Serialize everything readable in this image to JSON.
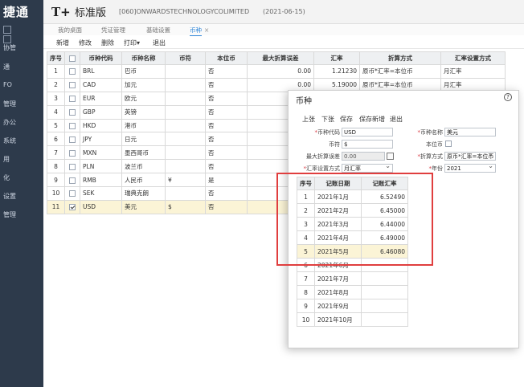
{
  "app": {
    "brand": "捷通",
    "logo_mark": "T+",
    "logo_text": "标准版",
    "company": "[060]ONWARDSTECHNOLOGYCOLIMITED",
    "date": "(2021-06-15)"
  },
  "sidebar": {
    "items": [
      "协管",
      "通",
      "FO",
      "管理",
      "办公",
      "系统",
      "用",
      "化",
      "设置",
      "管理"
    ]
  },
  "tabs": [
    {
      "label": "我的桌面"
    },
    {
      "label": "凭证管理"
    },
    {
      "label": "基础设置"
    },
    {
      "label": "币种",
      "close": "×"
    }
  ],
  "toolbar": {
    "add": "新增",
    "edit": "修改",
    "delete": "删除",
    "print": "打印",
    "print_caret": "▾",
    "exit": "退出"
  },
  "grid": {
    "headers": [
      "序号",
      "",
      "币种代码",
      "币种名称",
      "币符",
      "本位币",
      "最大折算误差",
      "汇率",
      "折算方式",
      "汇率设置方式"
    ],
    "rows": [
      {
        "no": "1",
        "code": "BRL",
        "name": "巴币",
        "symbol": "",
        "base": "否",
        "err": "0.00",
        "rate": "1.21230",
        "method": "原币*汇率=本位币",
        "setting": "月汇率",
        "checked": false
      },
      {
        "no": "2",
        "code": "CAD",
        "name": "加元",
        "symbol": "",
        "base": "否",
        "err": "0.00",
        "rate": "5.19000",
        "method": "原币*汇率=本位币",
        "setting": "月汇率",
        "checked": false
      },
      {
        "no": "3",
        "code": "EUR",
        "name": "欧元",
        "symbol": "",
        "base": "否",
        "err": "",
        "rate": "",
        "method": "",
        "setting": "",
        "checked": false
      },
      {
        "no": "4",
        "code": "GBP",
        "name": "英镑",
        "symbol": "",
        "base": "否",
        "err": "",
        "rate": "",
        "method": "",
        "setting": "",
        "checked": false
      },
      {
        "no": "5",
        "code": "HKD",
        "name": "港币",
        "symbol": "",
        "base": "否",
        "err": "",
        "rate": "",
        "method": "",
        "setting": "",
        "checked": false
      },
      {
        "no": "6",
        "code": "JPY",
        "name": "日元",
        "symbol": "",
        "base": "否",
        "err": "",
        "rate": "",
        "method": "",
        "setting": "",
        "checked": false
      },
      {
        "no": "7",
        "code": "MXN",
        "name": "墨西哥币",
        "symbol": "",
        "base": "否",
        "err": "",
        "rate": "",
        "method": "",
        "setting": "",
        "checked": false
      },
      {
        "no": "8",
        "code": "PLN",
        "name": "波兰币",
        "symbol": "",
        "base": "否",
        "err": "",
        "rate": "",
        "method": "",
        "setting": "",
        "checked": false
      },
      {
        "no": "9",
        "code": "RMB",
        "name": "人民币",
        "symbol": "¥",
        "base": "是",
        "err": "",
        "rate": "",
        "method": "",
        "setting": "",
        "checked": false
      },
      {
        "no": "10",
        "code": "SEK",
        "name": "瑞典克朗",
        "symbol": "",
        "base": "否",
        "err": "",
        "rate": "",
        "method": "",
        "setting": "",
        "checked": false
      },
      {
        "no": "11",
        "code": "USD",
        "name": "美元",
        "symbol": "$",
        "base": "否",
        "err": "",
        "rate": "",
        "method": "",
        "setting": "",
        "checked": true
      }
    ]
  },
  "modal": {
    "title": "币种",
    "help": "?",
    "buttons": {
      "prev": "上张",
      "next": "下张",
      "save": "保存",
      "save_new": "保存新增",
      "exit": "退出"
    },
    "form": {
      "code_label": "币种代码",
      "code_value": "USD",
      "name_label": "币种名称",
      "name_value": "美元",
      "symbol_label": "币符",
      "symbol_value": "$",
      "base_label": "本位币",
      "err_label": "最大折算误差",
      "err_value": "0.00",
      "method_label": "折算方式",
      "method_value": "原币*汇率=本位币",
      "rateset_label": "汇率设置方式",
      "rateset_value": "月汇率",
      "year_label": "年份",
      "year_value": "2021",
      "req": "*"
    },
    "rates": {
      "headers": [
        "序号",
        "记账日期",
        "记账汇率"
      ],
      "rows": [
        {
          "no": "1",
          "date": "2021年1月",
          "rate": "6.52490"
        },
        {
          "no": "2",
          "date": "2021年2月",
          "rate": "6.45000"
        },
        {
          "no": "3",
          "date": "2021年3月",
          "rate": "6.44000"
        },
        {
          "no": "4",
          "date": "2021年4月",
          "rate": "6.49000"
        },
        {
          "no": "5",
          "date": "2021年5月",
          "rate": "6.46080"
        },
        {
          "no": "6",
          "date": "2021年6月",
          "rate": ""
        },
        {
          "no": "7",
          "date": "2021年7月",
          "rate": ""
        },
        {
          "no": "8",
          "date": "2021年8月",
          "rate": ""
        },
        {
          "no": "9",
          "date": "2021年9月",
          "rate": ""
        },
        {
          "no": "10",
          "date": "2021年10月",
          "rate": ""
        }
      ]
    }
  },
  "colors": {
    "accent": "#2f86d8",
    "sidebar": "#2d3a4b",
    "highlight": "#e03e3e",
    "selected_row": "#fbf4d6"
  }
}
